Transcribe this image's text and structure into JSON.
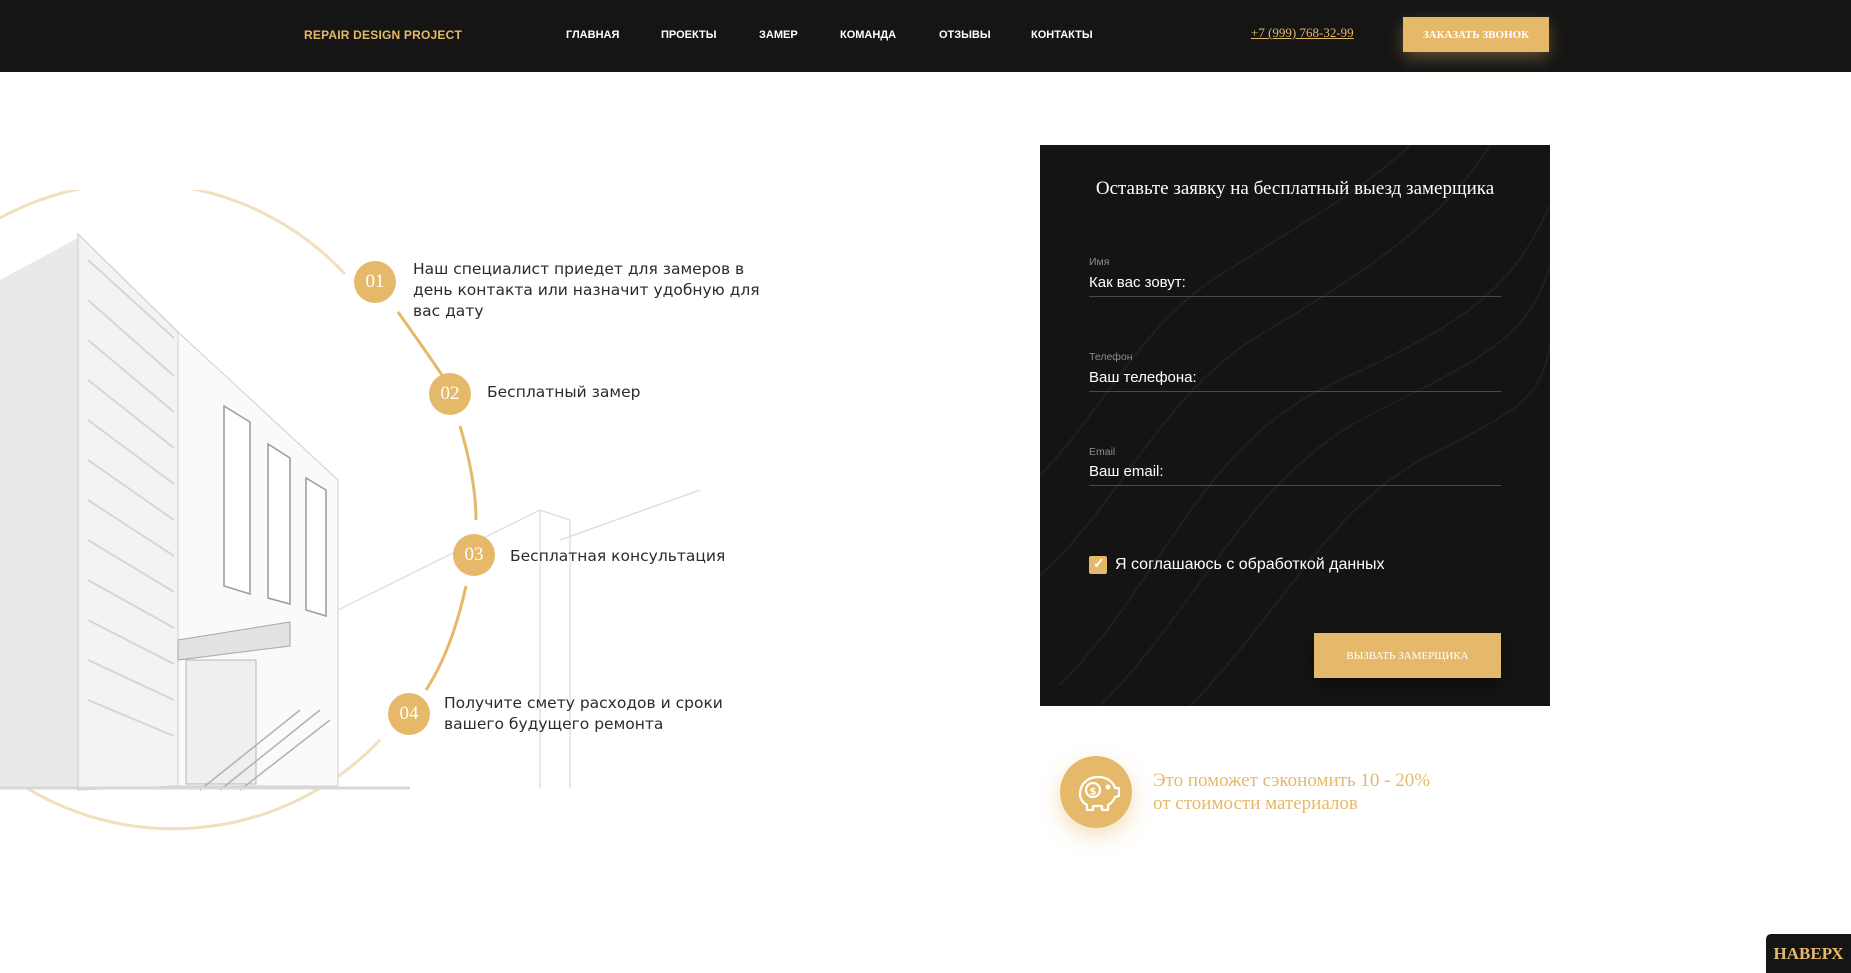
{
  "brand": {
    "logo_text": "REPAIR DESIGN PROJECT"
  },
  "nav": {
    "items": [
      {
        "label": "ГЛАВНАЯ"
      },
      {
        "label": "ПРОЕКТЫ"
      },
      {
        "label": "ЗАМЕР"
      },
      {
        "label": "КОМАНДА"
      },
      {
        "label": "ОТЗЫВЫ"
      },
      {
        "label": "КОНТАКТЫ"
      }
    ]
  },
  "header": {
    "phone": "+7 (999) 768-32-99",
    "call_button": "ЗАКАЗАТЬ ЗВОНОК"
  },
  "steps": [
    {
      "number": "01",
      "text": "Наш специалист приедет для замеров в день контакта или назначит удобную для вас дату"
    },
    {
      "number": "02",
      "text": "Бесплатный замер"
    },
    {
      "number": "03",
      "text": "Бесплатная консультация"
    },
    {
      "number": "04",
      "text": "Получите смету расходов и сроки вашего будущего ремонта"
    }
  ],
  "form": {
    "title": "Оставьте заявку на бесплатный выезд замерщика",
    "fields": [
      {
        "label": "Имя",
        "placeholder": "Как вас зовут:"
      },
      {
        "label": "Телефон",
        "placeholder": "Ваш телефона:"
      },
      {
        "label": "Email",
        "placeholder": "Ваш email:"
      }
    ],
    "consent_label": "Я соглашаюсь с обработкой данных",
    "consent_checked": true,
    "submit_label": "ВЫЗВАТЬ ЗАМЕРЩИКА"
  },
  "savings": {
    "icon": "piggy-bank-icon",
    "line1": "Это поможет сэкономить 10 - 20%",
    "line2": "от стоимости материалов"
  },
  "to_top": {
    "label": "НАВЕРХ"
  },
  "colors": {
    "accent": "#e6b96a",
    "dark": "#151515",
    "text": "#2b2b2b",
    "white": "#ffffff"
  }
}
